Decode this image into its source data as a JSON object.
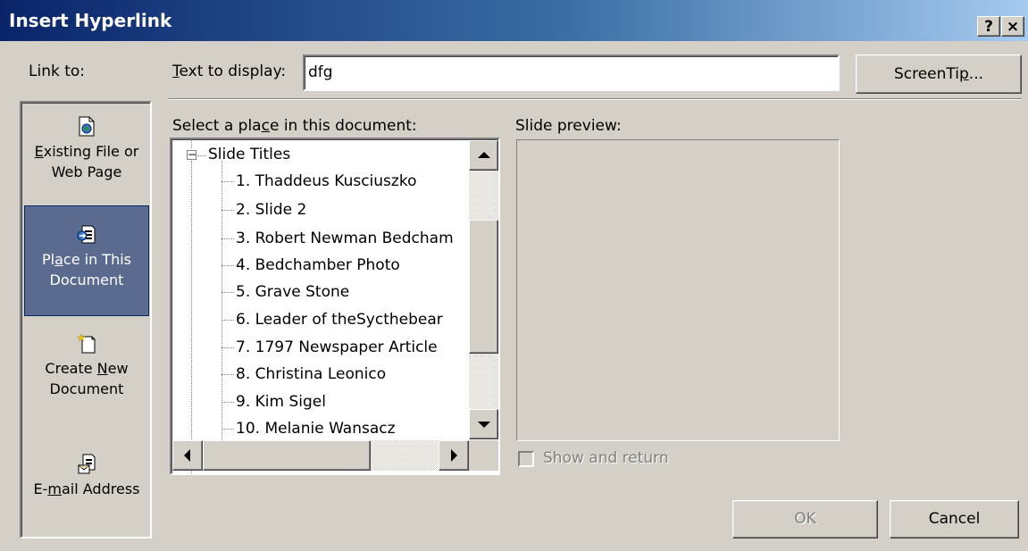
{
  "window": {
    "title": "Insert Hyperlink"
  },
  "titlebar": {
    "help_label": "?",
    "close_label": "×"
  },
  "link_to": {
    "label": "Link to:",
    "items": [
      {
        "line1": "Existing File or",
        "line2": "Web Page",
        "icon": "existing-file-icon",
        "selected": false
      },
      {
        "line1": "Place in This",
        "line2": "Document",
        "icon": "place-in-document-icon",
        "selected": true
      },
      {
        "line1": "Create New",
        "line2": "Document",
        "icon": "create-new-document-icon",
        "selected": false
      },
      {
        "line1": "E-mail Address",
        "line2": "",
        "icon": "email-address-icon",
        "selected": false
      }
    ]
  },
  "text_to_display": {
    "label": "Text to display:",
    "value": "dfg"
  },
  "screentip_button": {
    "label": "ScreenTip..."
  },
  "place_section": {
    "label": "Select a place in this document:"
  },
  "tree": {
    "root": "Slide Titles",
    "items": [
      "1. Thaddeus Kusciuszko",
      "2. Slide 2",
      "3. Robert Newman Bedcham",
      "4. Bedchamber Photo",
      "5. Grave Stone",
      "6. Leader of theSycthebear",
      "7. 1797 Newspaper Article",
      "8. Christina Leonico",
      "9. Kim Sigel",
      "10. Melanie Wansacz"
    ]
  },
  "preview": {
    "label": "Slide preview:"
  },
  "show_and_return": {
    "label": "Show and return",
    "checked": false,
    "enabled": false
  },
  "buttons": {
    "ok": "OK",
    "cancel": "Cancel"
  },
  "colors": {
    "selected_bg": "#5a6b8f",
    "title_start": "#0a246a",
    "title_end": "#a6caf0",
    "face": "#d4d0c8"
  }
}
